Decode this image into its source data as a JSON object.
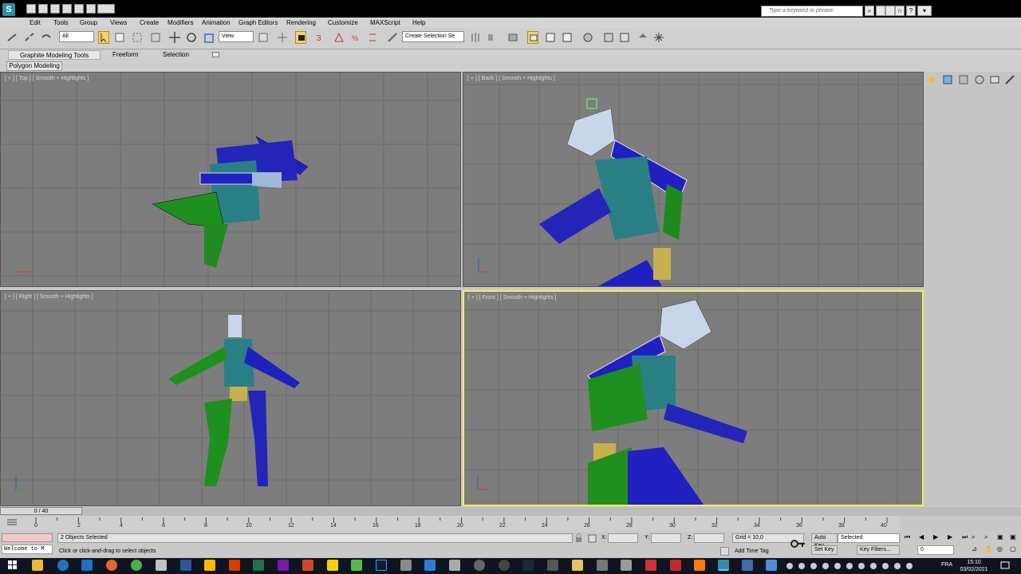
{
  "title_bar": {
    "search_placeholder": "Type a keyword or phrase"
  },
  "menu": {
    "items": [
      "Edit",
      "Tools",
      "Group",
      "Views",
      "Create",
      "Modifiers",
      "Animation",
      "Graph Editors",
      "Rendering",
      "Customize",
      "MAXScript",
      "Help"
    ]
  },
  "toolbar": {
    "selection_filter": "All",
    "reference_coord": "View",
    "named_selection_placeholder": "Create Selection Se"
  },
  "ribbon": {
    "tabs": [
      "Graphite Modeling Tools",
      "Freeform",
      "Selection"
    ],
    "panel_label": "Polygon Modeling"
  },
  "viewports": {
    "top": "[ + ] [ Top ] [ Smooth + Highlights ]",
    "back": "[ + ] [ Back ] [ Smooth + Highlights ]",
    "right": "[ + ] [ Right ] [ Smooth + Highlights ]",
    "front": "[ + ] [ Front ] [ Smooth + Highlights ]"
  },
  "timeline": {
    "frame_display": "0 / 40",
    "ticks": [
      "0",
      "2",
      "4",
      "6",
      "8",
      "10",
      "12",
      "14",
      "16",
      "18",
      "20",
      "22",
      "24",
      "26",
      "28",
      "30",
      "32",
      "34",
      "36",
      "38",
      "40"
    ]
  },
  "status": {
    "maxscript_text": "Welcome to M",
    "selection_info": "2 Objects Selected",
    "prompt": "Click or click-and-drag to select objects",
    "x_label": "X:",
    "y_label": "Y:",
    "z_label": "Z:",
    "grid": "Grid = 10,0",
    "add_time_tag": "Add Time Tag",
    "auto_key": "Auto Key",
    "set_key": "Set Key",
    "key_mode": "Selected",
    "key_filters": "Key Filters...",
    "current_frame": "0"
  },
  "taskbar": {
    "language": "FRA",
    "time": "15:10",
    "date": "03/02/2021"
  },
  "colors": {
    "viewport_bg": "#7d7d7d",
    "active_border": "#f1f15a",
    "grid_line": "#6c6c6c"
  }
}
